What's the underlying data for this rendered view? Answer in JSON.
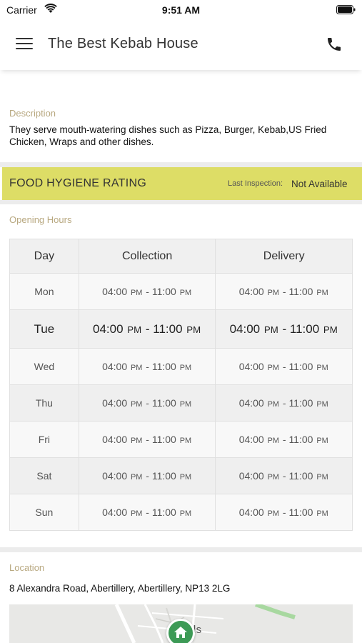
{
  "status_bar": {
    "carrier": "Carrier",
    "time": "9:51 AM"
  },
  "header": {
    "title": "The Best Kebab House"
  },
  "description": {
    "label": "Description",
    "text": "They serve mouth-watering dishes such as Pizza, Burger, Kebab,US Fried Chicken, Wraps  and other dishes."
  },
  "hygiene": {
    "title": "FOOD HYGIENE RATING",
    "inspection_label": "Last Inspection:",
    "inspection_value": "Not Available"
  },
  "opening_hours": {
    "label": "Opening Hours",
    "columns": [
      "Day",
      "Collection",
      "Delivery"
    ],
    "rows": [
      {
        "day": "Mon",
        "collection": {
          "start": "04:00",
          "start_ampm": "PM",
          "sep": "-",
          "end": "11:00",
          "end_ampm": "PM"
        },
        "delivery": {
          "start": "04:00",
          "start_ampm": "PM",
          "sep": "-",
          "end": "11:00",
          "end_ampm": "PM"
        }
      },
      {
        "day": "Tue",
        "collection": {
          "start": "04:00",
          "start_ampm": "PM",
          "sep": "-",
          "end": "11:00",
          "end_ampm": "PM"
        },
        "delivery": {
          "start": "04:00",
          "start_ampm": "PM",
          "sep": "-",
          "end": "11:00",
          "end_ampm": "PM"
        }
      },
      {
        "day": "Wed",
        "collection": {
          "start": "04:00",
          "start_ampm": "PM",
          "sep": "-",
          "end": "11:00",
          "end_ampm": "PM"
        },
        "delivery": {
          "start": "04:00",
          "start_ampm": "PM",
          "sep": "-",
          "end": "11:00",
          "end_ampm": "PM"
        }
      },
      {
        "day": "Thu",
        "collection": {
          "start": "04:00",
          "start_ampm": "PM",
          "sep": "-",
          "end": "11:00",
          "end_ampm": "PM"
        },
        "delivery": {
          "start": "04:00",
          "start_ampm": "PM",
          "sep": "-",
          "end": "11:00",
          "end_ampm": "PM"
        }
      },
      {
        "day": "Fri",
        "collection": {
          "start": "04:00",
          "start_ampm": "PM",
          "sep": "-",
          "end": "11:00",
          "end_ampm": "PM"
        },
        "delivery": {
          "start": "04:00",
          "start_ampm": "PM",
          "sep": "-",
          "end": "11:00",
          "end_ampm": "PM"
        }
      },
      {
        "day": "Sat",
        "collection": {
          "start": "04:00",
          "start_ampm": "PM",
          "sep": "-",
          "end": "11:00",
          "end_ampm": "PM"
        },
        "delivery": {
          "start": "04:00",
          "start_ampm": "PM",
          "sep": "-",
          "end": "11:00",
          "end_ampm": "PM"
        }
      },
      {
        "day": "Sun",
        "collection": {
          "start": "04:00",
          "start_ampm": "PM",
          "sep": "-",
          "end": "11:00",
          "end_ampm": "PM"
        },
        "delivery": {
          "start": "04:00",
          "start_ampm": "PM",
          "sep": "-",
          "end": "11:00",
          "end_ampm": "PM"
        }
      }
    ]
  },
  "location": {
    "label": "Location",
    "address": "8 Alexandra Road, Abertillery, Abertillery, NP13 2LG",
    "map_town_text": "S ells"
  },
  "icons": {
    "menu": "hamburger-menu-icon",
    "phone": "phone-icon",
    "map_pin": "home-map-pin-icon"
  },
  "colors": {
    "hygiene_banner": "#dddd66",
    "section_label": "#b8a880",
    "map_pin": "#3d9a56"
  }
}
